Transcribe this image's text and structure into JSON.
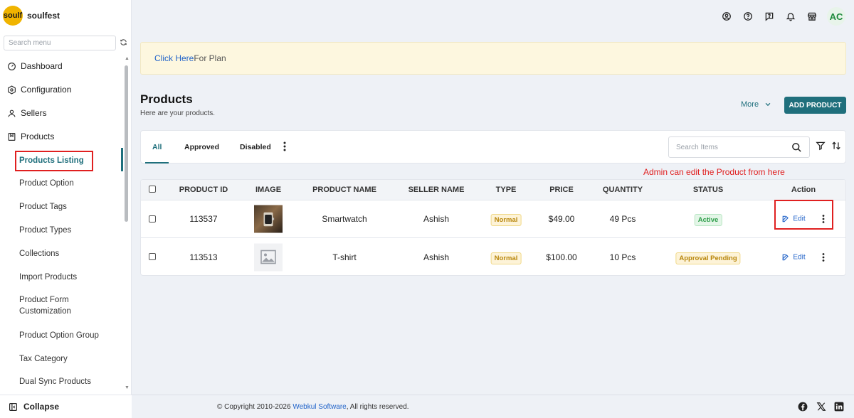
{
  "brand": {
    "logo_text": "soulf",
    "name": "soulfest"
  },
  "sidebar": {
    "search_placeholder": "Search menu",
    "items": [
      {
        "label": "Dashboard",
        "icon": "dashboard-icon"
      },
      {
        "label": "Configuration",
        "icon": "hexagon-settings-icon"
      },
      {
        "label": "Sellers",
        "icon": "user-icon"
      },
      {
        "label": "Products",
        "icon": "bookmark-box-icon"
      }
    ],
    "sub_items": [
      "Products Listing",
      "Product Option",
      "Product Tags",
      "Product Types",
      "Collections",
      "Import Products",
      "Product Form Customization",
      "Product Option Group",
      "Tax Category",
      "Dual Sync Products"
    ],
    "active_sub": "Products Listing",
    "collapse_label": "Collapse"
  },
  "topbar": {
    "icons": [
      "account-circle-icon",
      "help-circle-icon",
      "question-box-icon",
      "bell-icon",
      "store-icon"
    ],
    "avatar": "AC"
  },
  "banner": {
    "link_text": "Click Here",
    "rest_text": "For Plan"
  },
  "page": {
    "title": "Products",
    "subtitle": "Here are your products.",
    "more_label": "More",
    "add_button": "ADD PRODUCT"
  },
  "tabs": [
    "All",
    "Approved",
    "Disabled"
  ],
  "search_items_placeholder": "Search Items",
  "annotation": "Admin can edit the Product from here",
  "table": {
    "headers": [
      "PRODUCT ID",
      "IMAGE",
      "PRODUCT NAME",
      "SELLER NAME",
      "TYPE",
      "PRICE",
      "QUANTITY",
      "STATUS",
      "Action"
    ],
    "rows": [
      {
        "id": "113537",
        "image": "smartwatch-photo",
        "name": "Smartwatch",
        "seller": "Ashish",
        "type": "Normal",
        "price": "$49.00",
        "quantity": "49 Pcs",
        "status": "Active",
        "action": "Edit"
      },
      {
        "id": "113513",
        "image": "image-placeholder-icon",
        "name": "T-shirt",
        "seller": "Ashish",
        "type": "Normal",
        "price": "$100.00",
        "quantity": "10 Pcs",
        "status": "Approval Pending",
        "action": "Edit"
      }
    ]
  },
  "footer": {
    "copyright_prefix": "© Copyright 2010-2026 ",
    "company": "Webkul Software",
    "copyright_suffix": ", All rights reserved.",
    "social": [
      "facebook-icon",
      "x-icon",
      "linkedin-icon"
    ]
  },
  "colors": {
    "accent": "#1f6f7c",
    "link": "#2264c9",
    "highlight": "#e02020",
    "banner_bg": "#fdf7df"
  }
}
